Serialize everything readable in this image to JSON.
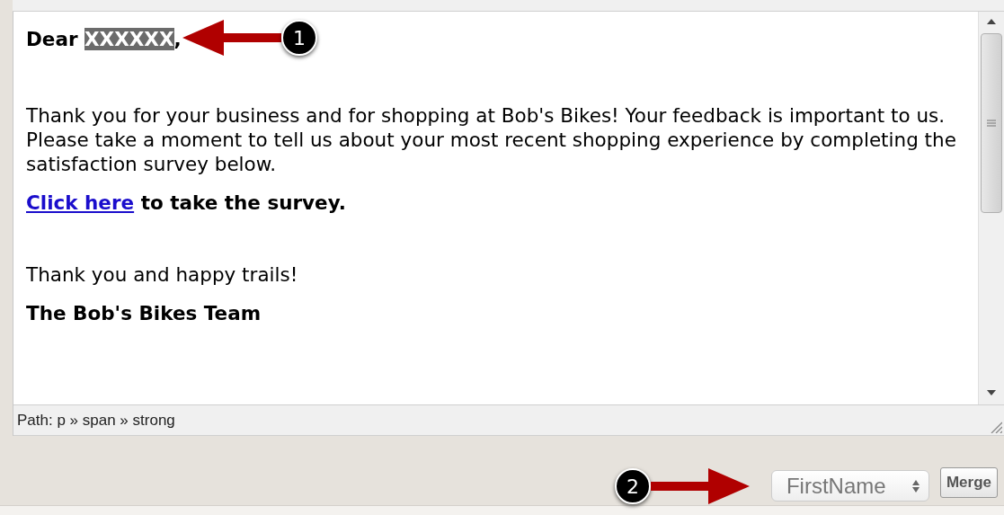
{
  "editor": {
    "greeting": {
      "prefix": "Dear",
      "token": "XXXXXX",
      "token_selected": true,
      "suffix": ","
    },
    "paragraphs": [
      {
        "kind": "text",
        "text": "Thank you for your business and for shopping at Bob's Bikes! Your feedback is important to us. Please take a moment to tell us about your most recent shopping experience by completing the satisfaction survey below."
      },
      {
        "kind": "link",
        "link": "Click here",
        "text": "to take the survey."
      },
      {
        "kind": "spacer"
      },
      {
        "kind": "text",
        "text": "Thank you and happy trails!"
      },
      {
        "kind": "bold",
        "text": "The Bob's Bikes Team"
      }
    ],
    "path": "Path: p » span » strong"
  },
  "merge": {
    "field": "FirstName",
    "button": "Merge"
  },
  "callouts": [
    {
      "number": "1"
    },
    {
      "number": "2"
    }
  ]
}
